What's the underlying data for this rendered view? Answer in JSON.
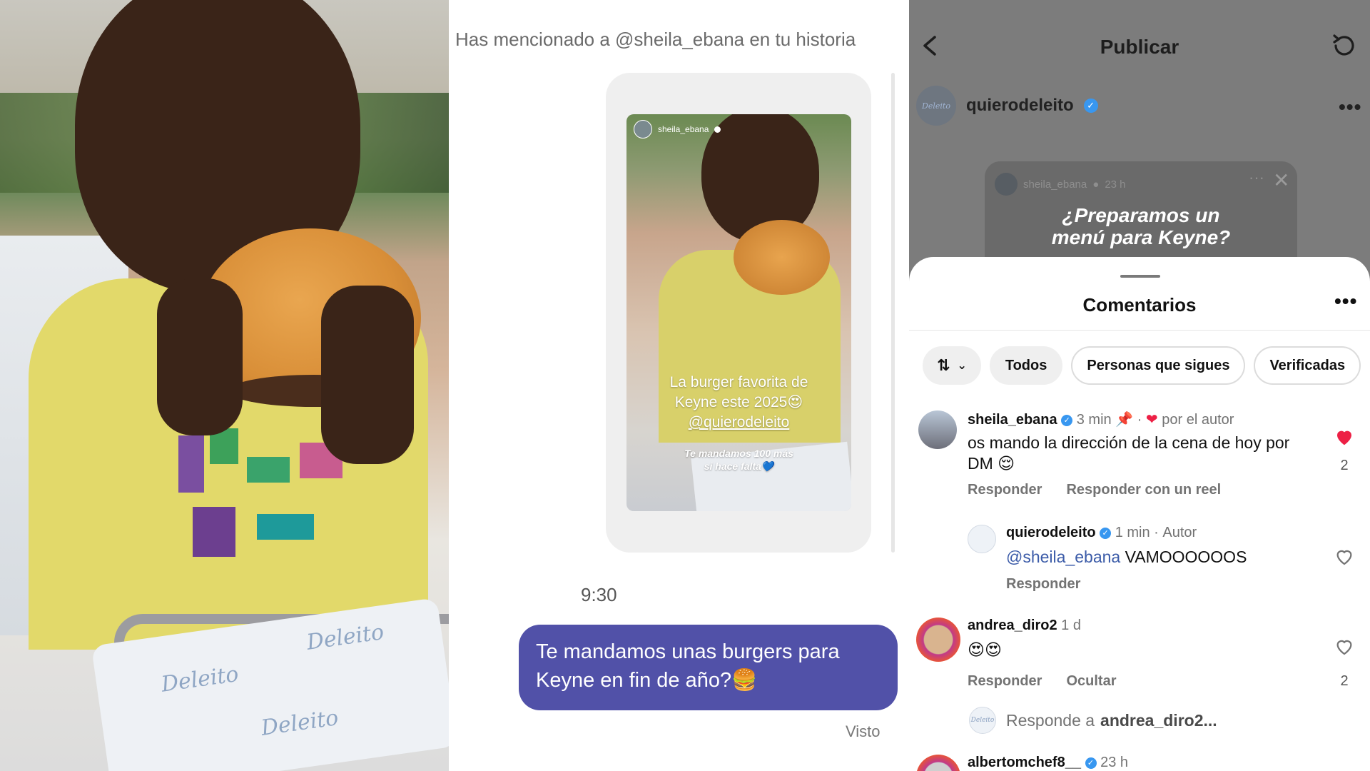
{
  "dm": {
    "mention_text": "Has mencionado a @sheila_ebana en tu historia",
    "story": {
      "username": "sheila_ebana",
      "caption_line1": "La burger favorita de",
      "caption_line2": "Keyne este 2025😍",
      "caption_link": "@quierodeleito",
      "sub_line1": "Te mandamos 100 más",
      "sub_line2": "si hace falta💙"
    },
    "time": "9:30",
    "message": "Te mandamos unas burgers para Keyne en fin de año?🍔",
    "seen": "Visto"
  },
  "post": {
    "header_title": "Publicar",
    "author": "quierodeleito",
    "avatar_text": "Deleito",
    "story_preview": {
      "username": "sheila_ebana",
      "time": "23 h",
      "text_line1": "¿Preparamos un",
      "text_line2": "menú para Keyne?"
    }
  },
  "comments_sheet": {
    "title": "Comentarios",
    "filters": [
      "Todos",
      "Personas que sigues",
      "Verificadas"
    ],
    "comments": [
      {
        "user": "sheila_ebana",
        "time": "3 min",
        "pinned_suffix": "por el autor",
        "text": "os mando la dirección de la cena de hoy por DM 😌",
        "actions": [
          "Responder",
          "Responder con un reel"
        ],
        "likes": "2",
        "liked": true
      },
      {
        "user": "quierodeleito",
        "time": "1 min",
        "badge": "Autor",
        "mention": "@sheila_ebana",
        "text": "VAMOOOOOOS",
        "actions": [
          "Responder"
        ]
      },
      {
        "user": "andrea_diro2",
        "time": "1 d",
        "text": "😍😍",
        "actions": [
          "Responder",
          "Ocultar"
        ],
        "likes": "2"
      },
      {
        "user": "albertomchef8__",
        "time": "23 h"
      }
    ],
    "reply_prefix": "Responde a",
    "reply_target": "andrea_diro2..."
  },
  "colors": {
    "dm_bubble": "#5151a8",
    "like_red": "#ed2045",
    "verified_blue": "#3897f0"
  }
}
